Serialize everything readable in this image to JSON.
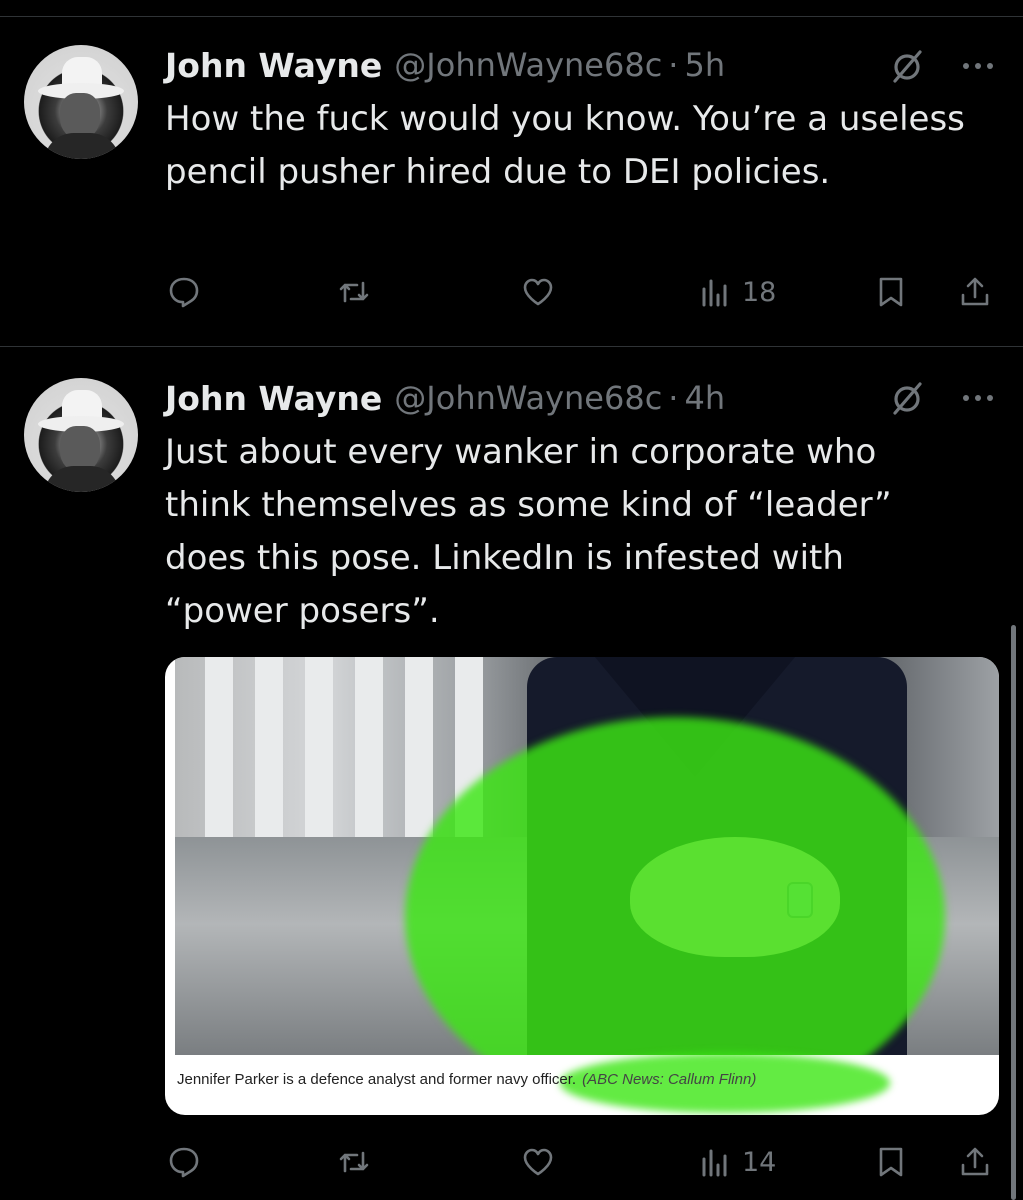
{
  "tweets": [
    {
      "author_name": "John Wayne",
      "handle": "@JohnWayne68c",
      "separator": "·",
      "time": "5h",
      "text": "How the fuck would you know. You’re a useless pencil pusher hired due to DEI policies.",
      "views": "18"
    },
    {
      "author_name": "John Wayne",
      "handle": "@JohnWayne68c",
      "separator": "·",
      "time": "4h",
      "text": "Just about every wanker in corporate who think themselves as some kind of “leader” does this pose. LinkedIn is infested with “power posers”.",
      "views": "14",
      "media": {
        "caption": "Jennifer Parker is a defence analyst and former navy officer.",
        "credit": "(ABC News: Callum Flinn)"
      }
    }
  ],
  "colors": {
    "background": "#000000",
    "text": "#e7e9ea",
    "secondary": "#71767b",
    "highlight": "#3ce614"
  },
  "icons": [
    "grok-icon",
    "more-icon",
    "reply-icon",
    "retweet-icon",
    "like-icon",
    "views-icon",
    "bookmark-icon",
    "share-icon"
  ]
}
